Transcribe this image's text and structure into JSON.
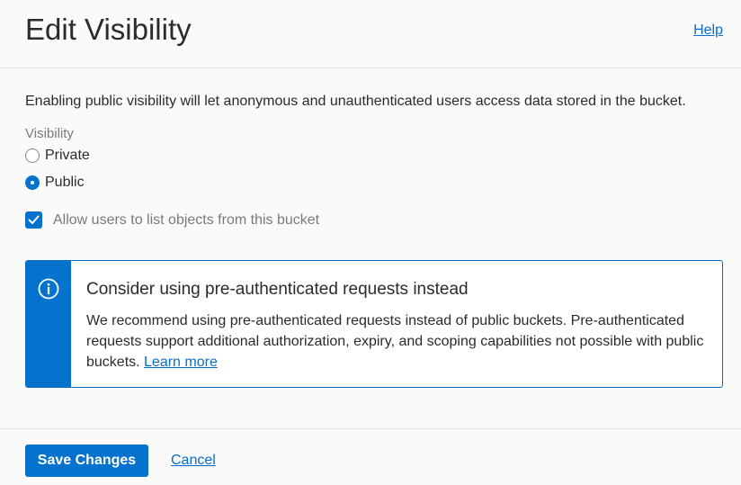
{
  "header": {
    "title": "Edit Visibility",
    "help_label": "Help"
  },
  "body": {
    "intro": "Enabling public visibility will let anonymous and unauthenticated users access data stored in the bucket.",
    "visibility_label": "Visibility",
    "options": [
      {
        "label": "Private",
        "checked": false
      },
      {
        "label": "Public",
        "checked": true
      }
    ],
    "list_objects_label": "Allow users to list objects from this bucket",
    "list_objects_checked": true
  },
  "notice": {
    "icon": "info-icon",
    "title": "Consider using pre-authenticated requests instead",
    "text": "We recommend using pre-authenticated requests instead of public buckets. Pre-authenticated requests support additional authorization, expiry, and scoping capabilities not possible with public buckets. ",
    "link_label": "Learn more"
  },
  "footer": {
    "save_label": "Save Changes",
    "cancel_label": "Cancel"
  },
  "colors": {
    "accent": "#0572ce",
    "link": "#0a6ecb"
  }
}
